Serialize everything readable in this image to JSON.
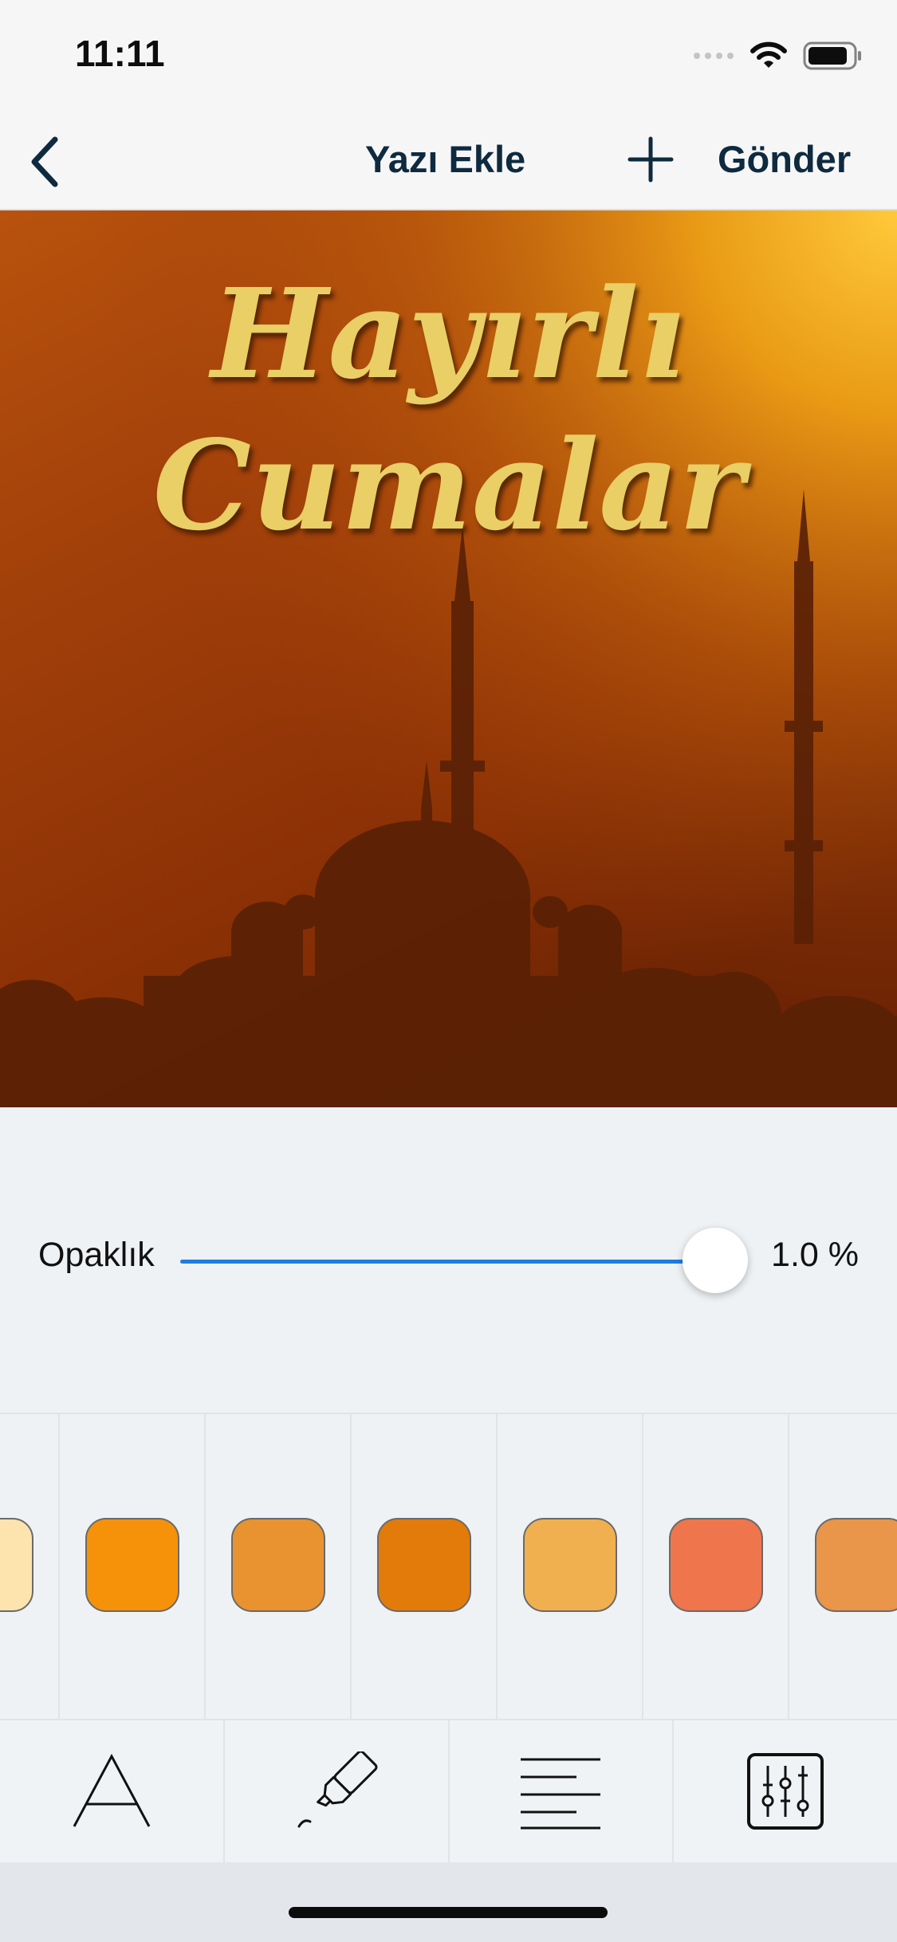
{
  "status_bar": {
    "time": "11:11",
    "icons": [
      "signal-icon",
      "wifi-icon",
      "battery-icon"
    ]
  },
  "nav": {
    "back_icon": "chevron-left-icon",
    "add_text_label": "Yazı Ekle",
    "plus_icon": "plus-icon",
    "send_label": "Gönder"
  },
  "photo": {
    "caption_line1": "Hayırlı",
    "caption_line2": "Cumalar",
    "caption_color": "#e9cf66",
    "scene": "mosque-silhouette-sunset"
  },
  "opacity": {
    "label": "Opaklık",
    "value_text": "1.0 %",
    "level": 1.0,
    "accent": "#1f7de0"
  },
  "swatches": [
    {
      "color": "#fde4ae"
    },
    {
      "color": "#f6920a"
    },
    {
      "color": "#e89330"
    },
    {
      "color": "#e37b0a"
    },
    {
      "color": "#f1b04f"
    },
    {
      "color": "#ef754c"
    },
    {
      "color": "#e9954a"
    }
  ],
  "toolbar": {
    "items": [
      {
        "icon": "font-icon"
      },
      {
        "icon": "highlighter-icon"
      },
      {
        "icon": "text-align-icon"
      },
      {
        "icon": "sliders-icon"
      }
    ]
  }
}
